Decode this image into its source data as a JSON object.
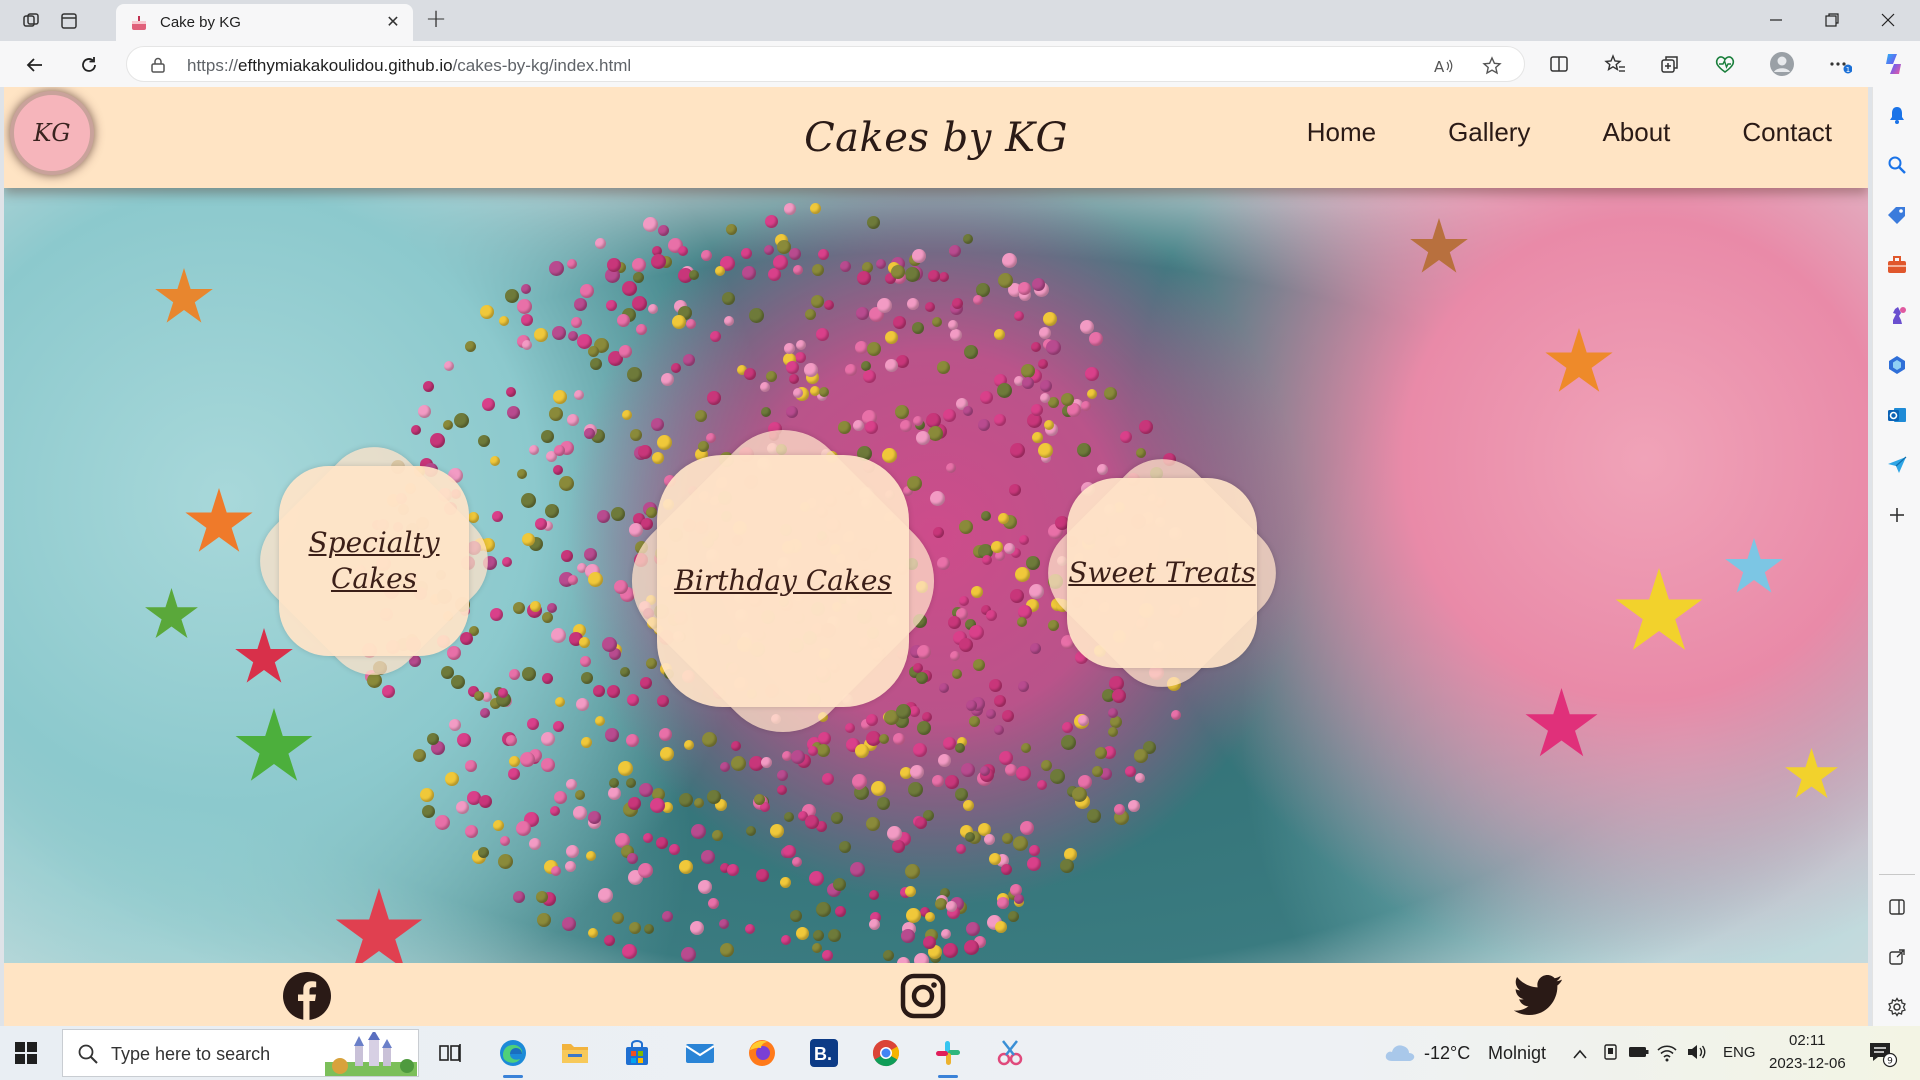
{
  "browser": {
    "tab_title": "Cake by KG",
    "url_prefix": "https://",
    "url_host": "efthymiakakoulidou.github.io",
    "url_path": "/cakes-by-kg/index.html",
    "notification_badge": "1"
  },
  "site": {
    "logo_text": "KG",
    "title": "Cakes by KG",
    "nav": [
      "Home",
      "Gallery",
      "About",
      "Contact"
    ],
    "categories": [
      "Specialty Cakes",
      "Birthday Cakes",
      "Sweet Treats"
    ],
    "footer_icons": [
      "facebook-icon",
      "instagram-icon",
      "twitter-icon"
    ],
    "colors": {
      "header_bg": "#ffe4c4",
      "text": "#2a1a16"
    }
  },
  "taskbar": {
    "search_placeholder": "Type here to search",
    "weather_temp": "-12°C",
    "weather_desc": "Molnigt",
    "language": "ENG",
    "time": "02:11",
    "date": "2023-12-06",
    "notification_count": "9"
  }
}
